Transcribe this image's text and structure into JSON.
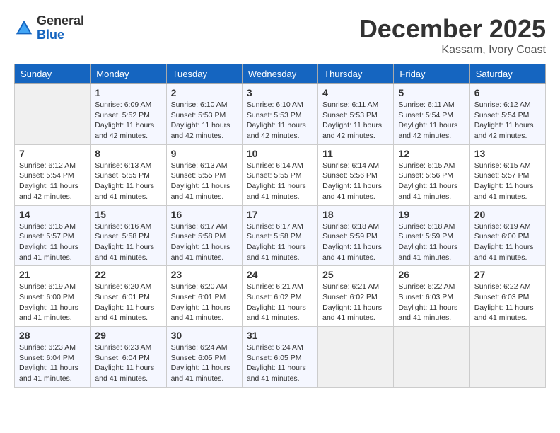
{
  "logo": {
    "general": "General",
    "blue": "Blue"
  },
  "title": "December 2025",
  "location": "Kassam, Ivory Coast",
  "days_of_week": [
    "Sunday",
    "Monday",
    "Tuesday",
    "Wednesday",
    "Thursday",
    "Friday",
    "Saturday"
  ],
  "weeks": [
    [
      {
        "day": "",
        "info": ""
      },
      {
        "day": "1",
        "info": "Sunrise: 6:09 AM\nSunset: 5:52 PM\nDaylight: 11 hours and 42 minutes."
      },
      {
        "day": "2",
        "info": "Sunrise: 6:10 AM\nSunset: 5:53 PM\nDaylight: 11 hours and 42 minutes."
      },
      {
        "day": "3",
        "info": "Sunrise: 6:10 AM\nSunset: 5:53 PM\nDaylight: 11 hours and 42 minutes."
      },
      {
        "day": "4",
        "info": "Sunrise: 6:11 AM\nSunset: 5:53 PM\nDaylight: 11 hours and 42 minutes."
      },
      {
        "day": "5",
        "info": "Sunrise: 6:11 AM\nSunset: 5:54 PM\nDaylight: 11 hours and 42 minutes."
      },
      {
        "day": "6",
        "info": "Sunrise: 6:12 AM\nSunset: 5:54 PM\nDaylight: 11 hours and 42 minutes."
      }
    ],
    [
      {
        "day": "7",
        "info": "Sunrise: 6:12 AM\nSunset: 5:54 PM\nDaylight: 11 hours and 42 minutes."
      },
      {
        "day": "8",
        "info": "Sunrise: 6:13 AM\nSunset: 5:55 PM\nDaylight: 11 hours and 41 minutes."
      },
      {
        "day": "9",
        "info": "Sunrise: 6:13 AM\nSunset: 5:55 PM\nDaylight: 11 hours and 41 minutes."
      },
      {
        "day": "10",
        "info": "Sunrise: 6:14 AM\nSunset: 5:55 PM\nDaylight: 11 hours and 41 minutes."
      },
      {
        "day": "11",
        "info": "Sunrise: 6:14 AM\nSunset: 5:56 PM\nDaylight: 11 hours and 41 minutes."
      },
      {
        "day": "12",
        "info": "Sunrise: 6:15 AM\nSunset: 5:56 PM\nDaylight: 11 hours and 41 minutes."
      },
      {
        "day": "13",
        "info": "Sunrise: 6:15 AM\nSunset: 5:57 PM\nDaylight: 11 hours and 41 minutes."
      }
    ],
    [
      {
        "day": "14",
        "info": "Sunrise: 6:16 AM\nSunset: 5:57 PM\nDaylight: 11 hours and 41 minutes."
      },
      {
        "day": "15",
        "info": "Sunrise: 6:16 AM\nSunset: 5:58 PM\nDaylight: 11 hours and 41 minutes."
      },
      {
        "day": "16",
        "info": "Sunrise: 6:17 AM\nSunset: 5:58 PM\nDaylight: 11 hours and 41 minutes."
      },
      {
        "day": "17",
        "info": "Sunrise: 6:17 AM\nSunset: 5:58 PM\nDaylight: 11 hours and 41 minutes."
      },
      {
        "day": "18",
        "info": "Sunrise: 6:18 AM\nSunset: 5:59 PM\nDaylight: 11 hours and 41 minutes."
      },
      {
        "day": "19",
        "info": "Sunrise: 6:18 AM\nSunset: 5:59 PM\nDaylight: 11 hours and 41 minutes."
      },
      {
        "day": "20",
        "info": "Sunrise: 6:19 AM\nSunset: 6:00 PM\nDaylight: 11 hours and 41 minutes."
      }
    ],
    [
      {
        "day": "21",
        "info": "Sunrise: 6:19 AM\nSunset: 6:00 PM\nDaylight: 11 hours and 41 minutes."
      },
      {
        "day": "22",
        "info": "Sunrise: 6:20 AM\nSunset: 6:01 PM\nDaylight: 11 hours and 41 minutes."
      },
      {
        "day": "23",
        "info": "Sunrise: 6:20 AM\nSunset: 6:01 PM\nDaylight: 11 hours and 41 minutes."
      },
      {
        "day": "24",
        "info": "Sunrise: 6:21 AM\nSunset: 6:02 PM\nDaylight: 11 hours and 41 minutes."
      },
      {
        "day": "25",
        "info": "Sunrise: 6:21 AM\nSunset: 6:02 PM\nDaylight: 11 hours and 41 minutes."
      },
      {
        "day": "26",
        "info": "Sunrise: 6:22 AM\nSunset: 6:03 PM\nDaylight: 11 hours and 41 minutes."
      },
      {
        "day": "27",
        "info": "Sunrise: 6:22 AM\nSunset: 6:03 PM\nDaylight: 11 hours and 41 minutes."
      }
    ],
    [
      {
        "day": "28",
        "info": "Sunrise: 6:23 AM\nSunset: 6:04 PM\nDaylight: 11 hours and 41 minutes."
      },
      {
        "day": "29",
        "info": "Sunrise: 6:23 AM\nSunset: 6:04 PM\nDaylight: 11 hours and 41 minutes."
      },
      {
        "day": "30",
        "info": "Sunrise: 6:24 AM\nSunset: 6:05 PM\nDaylight: 11 hours and 41 minutes."
      },
      {
        "day": "31",
        "info": "Sunrise: 6:24 AM\nSunset: 6:05 PM\nDaylight: 11 hours and 41 minutes."
      },
      {
        "day": "",
        "info": ""
      },
      {
        "day": "",
        "info": ""
      },
      {
        "day": "",
        "info": ""
      }
    ]
  ]
}
